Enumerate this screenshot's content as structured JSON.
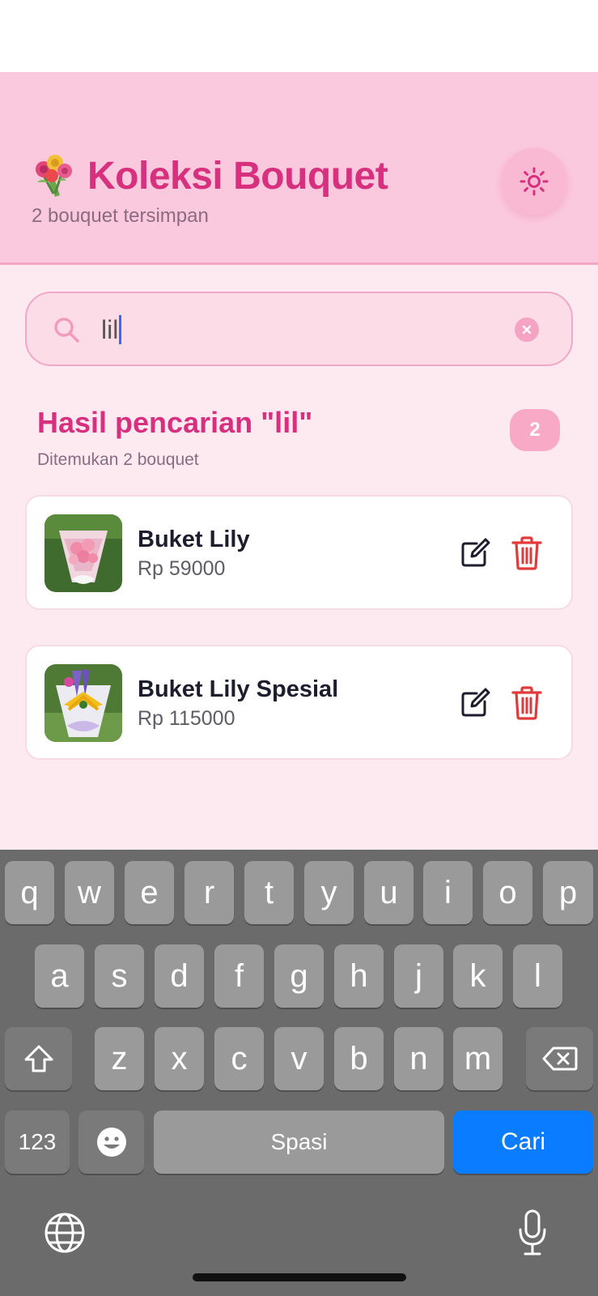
{
  "header": {
    "title": "Koleksi Bouquet",
    "subtitle": "2 bouquet tersimpan",
    "theme_icon": "sun-icon"
  },
  "search": {
    "value": "lil",
    "icon": "search-icon",
    "clear_icon": "close-icon"
  },
  "results": {
    "title": "Hasil pencarian \"lil\"",
    "subtitle": "Ditemukan 2 bouquet",
    "count": "2"
  },
  "items": [
    {
      "name": "Buket Lily",
      "price": "Rp 59000"
    },
    {
      "name": "Buket Lily Spesial",
      "price": "Rp 115000"
    }
  ],
  "keyboard": {
    "row1": [
      "q",
      "w",
      "e",
      "r",
      "t",
      "y",
      "u",
      "i",
      "o",
      "p"
    ],
    "row2": [
      "a",
      "s",
      "d",
      "f",
      "g",
      "h",
      "j",
      "k",
      "l"
    ],
    "row3": [
      "z",
      "x",
      "c",
      "v",
      "b",
      "n",
      "m"
    ],
    "numbers_label": "123",
    "space_label": "Spasi",
    "action_label": "Cari"
  },
  "colors": {
    "accent": "#d6307f",
    "header_bg": "#fbc9dd",
    "content_bg": "#fdeaf1",
    "delete": "#e23a3a",
    "action_key": "#0a7cff"
  }
}
